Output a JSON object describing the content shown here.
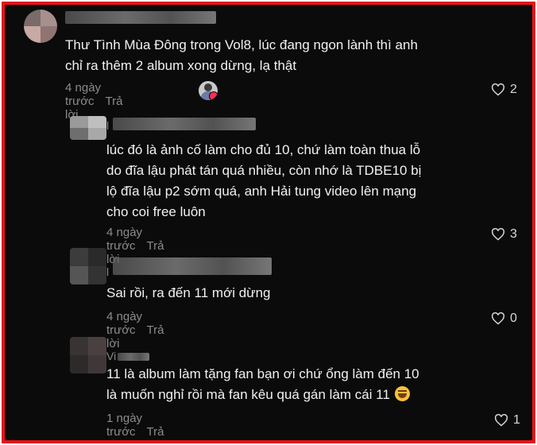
{
  "comments": [
    {
      "username": "",
      "text": "Thư Tình Mùa Đông trong Vol8, lúc đang ngon lành thì anh\nchỉ ra thêm 2 album xong dừng, lạ thật",
      "time": "4 ngày trước",
      "reply_label": "Trả lời",
      "likes": "2"
    },
    {
      "username": "l",
      "text": "lúc đó là ảnh cố làm cho đủ 10, chứ làm toàn thua lỗ\ndo đĩa lậu phát tán quá nhiều, còn nhớ là TDBE10 bị\nlộ đĩa lậu p2 sớm quá, anh Hải tung video lên mạng\ncho coi free luôn",
      "time": "4 ngày trước",
      "reply_label": "Trả lời",
      "likes": "3"
    },
    {
      "username": "l",
      "text": "Sai rồi, ra đến 11 mới dừng",
      "time": "4 ngày trước",
      "reply_label": "Trả lời",
      "likes": "0"
    },
    {
      "username": "Vi",
      "text": "11 là album làm tặng fan bạn ơi chứ ổng làm đến 10\nlà muốn nghỉ rồi mà fan kêu quá gán làm cái 11",
      "emoji": "grinning-face-emoji",
      "time": "1 ngày trước",
      "reply_label": "Trả lời",
      "likes": "1"
    }
  ],
  "colors": {
    "frame_border": "#e2141c",
    "background": "#0b0b0b",
    "text": "#f1f1f1",
    "meta": "#8c8c8c",
    "creator_heart": "#fe2c55"
  }
}
